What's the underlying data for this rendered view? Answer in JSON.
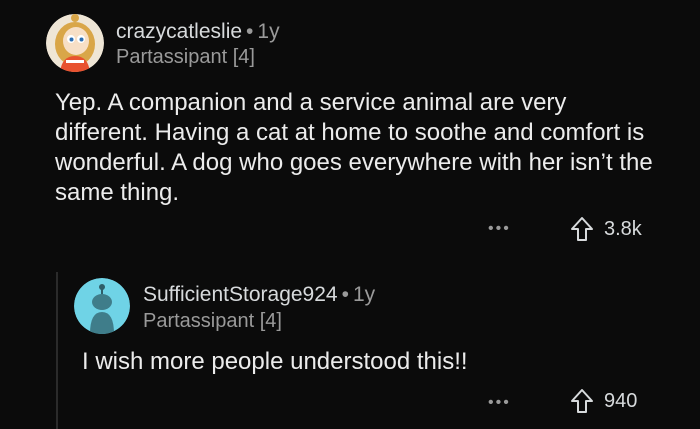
{
  "comments": [
    {
      "username": "crazycatleslie",
      "separator": "•",
      "age": "1y",
      "flair": "Partassipant [4]",
      "body": "Yep. A companion and a service animal are very different. Having a cat at home to soothe and comfort is wonderful. A dog who goes everywhere with her isn’t the same thing.",
      "more": "•••",
      "votes": "3.8k"
    },
    {
      "username": "SufficientStorage924",
      "separator": "•",
      "age": "1y",
      "flair": "Partassipant [4]",
      "body": "I wish more people understood this!!",
      "more": "•••",
      "votes": "940"
    }
  ],
  "colors": {
    "background": "#0b0b0b",
    "avatar_blue": "#6fd3e6",
    "text_muted": "#9a9a9a"
  },
  "icons": [
    "user-avatar-icon",
    "upvote-arrow-icon",
    "more-options-icon"
  ]
}
